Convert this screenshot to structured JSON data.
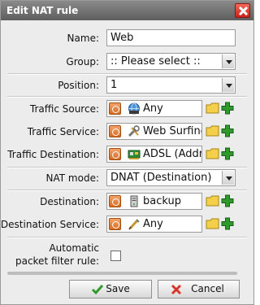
{
  "dialog": {
    "title": "Edit NAT rule"
  },
  "form": {
    "name_label": "Name:",
    "name_value": "Web",
    "group_label": "Group:",
    "group_value": ":: Please select ::",
    "position_label": "Position:",
    "position_value": "1",
    "traffic_source_label": "Traffic Source:",
    "traffic_source_value": "Any",
    "traffic_service_label": "Traffic Service:",
    "traffic_service_value": "Web Surfing",
    "traffic_destination_label": "Traffic Destination:",
    "traffic_destination_value": "ADSL (Addre",
    "nat_mode_label": "NAT mode:",
    "nat_mode_value": "DNAT (Destination)",
    "destination_label": "Destination:",
    "destination_value": "backup",
    "destination_service_label": "Destination Service:",
    "destination_service_value": "Any",
    "auto_filter_label_line1": "Automatic",
    "auto_filter_label_line2": "packet filter rule:",
    "auto_filter_checked": false
  },
  "buttons": {
    "save_label": "Save",
    "cancel_label": "Cancel"
  },
  "icons": {
    "priority": "priority-icon",
    "network_any": "globe-network-icon",
    "service": "wrench-service-icon",
    "interface": "network-card-icon",
    "host": "server-host-icon",
    "service_any": "pen-service-icon",
    "folder": "folder-icon",
    "add": "plus-icon"
  },
  "colors": {
    "titlebar": "#6e6e6e",
    "close_button": "#d8342a",
    "add_green": "#2e9a2a",
    "folder_yellow": "#f4d04a"
  }
}
